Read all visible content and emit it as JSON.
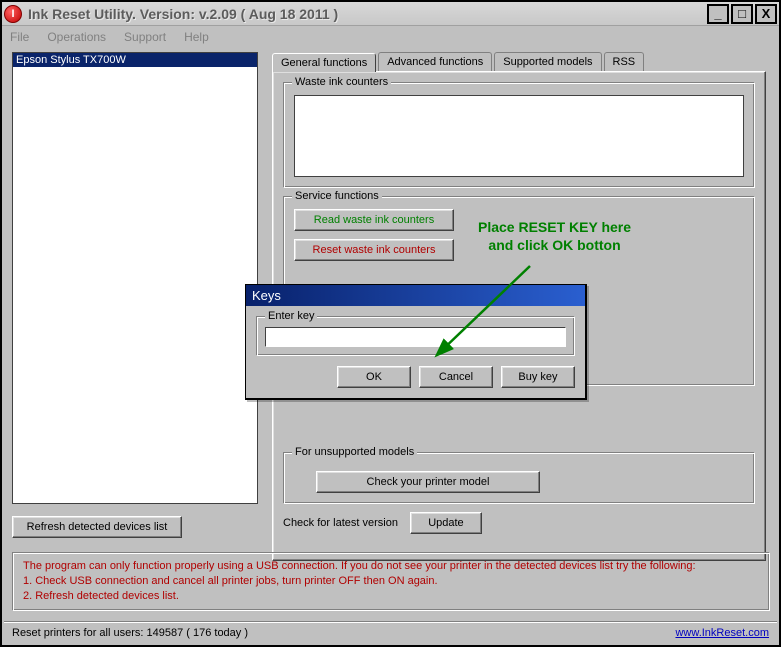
{
  "window": {
    "title": "Ink Reset Utility. Version: v.2.09 ( Aug 18 2011 )"
  },
  "menu": {
    "file": "File",
    "operations": "Operations",
    "support": "Support",
    "help": "Help"
  },
  "devices": {
    "item0": "Epson Stylus TX700W",
    "refresh": "Refresh detected devices list"
  },
  "tabs": {
    "general": "General functions",
    "advanced": "Advanced functions",
    "supported": "Supported models",
    "rss": "RSS"
  },
  "groups": {
    "waste": "Waste ink counters",
    "service": "Service functions",
    "unsupported": "For unsupported models",
    "check_version": "Check for latest version"
  },
  "buttons": {
    "read_waste": "Read waste ink counters",
    "reset_waste": "Reset waste ink counters",
    "check_model": "Check your printer model",
    "update": "Update"
  },
  "dialog": {
    "title": "Keys",
    "group": "Enter key",
    "value": "",
    "ok": "OK",
    "cancel": "Cancel",
    "buy": "Buy key"
  },
  "annotation": {
    "line1": "Place RESET KEY here",
    "line2": "and click OK botton"
  },
  "info": {
    "l1": "The program can only function properly using a USB connection. If you do not see your printer in the detected devices list try the following:",
    "l2": "1. Check USB connection and cancel all printer jobs, turn printer OFF then ON again.",
    "l3": "2. Refresh detected devices list."
  },
  "status": {
    "text": "Reset printers for all users: 149587 ( 176 today )",
    "link": "www.InkReset.com"
  }
}
